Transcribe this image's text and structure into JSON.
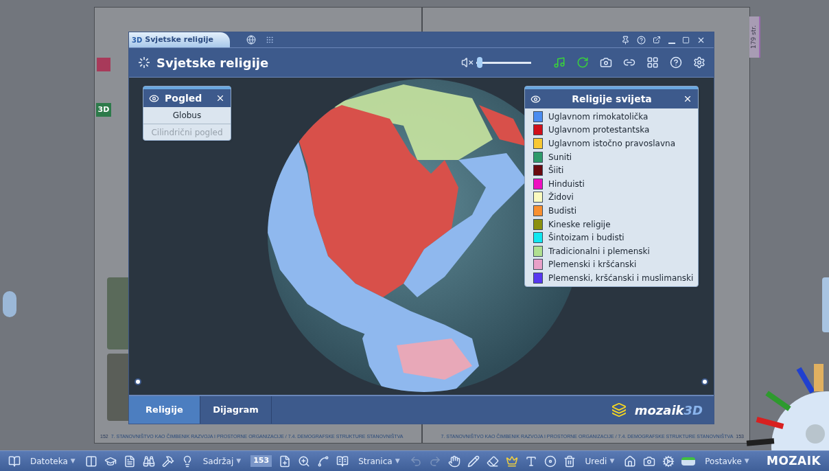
{
  "book": {
    "side_badge": "3D",
    "page_tab": "179 str.",
    "footer_left": {
      "number": "152",
      "text": "7. STANOVNIŠTVO KAO ČIMBENIK RAZVOJA I PROSTORNE ORGANIZACIJE / 7.4. DEMOGRAFSKE STRUKTURE STANOVNIŠTVA"
    },
    "footer_right": {
      "number": "153",
      "text": "7. STANOVNIŠTVO KAO ČIMBENIK RAZVOJA I PROSTORNE ORGANIZACIJE / 7.4. DEMOGRAFSKE STRUKTURE STANOVNIŠTVA"
    }
  },
  "window": {
    "tab_badge": "3D",
    "tab_title": "Svjetske religije",
    "title": "Svjetske religije",
    "volume": {
      "muted": true,
      "level": 0.04
    }
  },
  "view_panel": {
    "title": "Pogled",
    "items": [
      {
        "label": "Globus",
        "selected": true
      },
      {
        "label": "Cilindrični pogled",
        "selected": false
      }
    ]
  },
  "legend": {
    "title": "Religije svijeta",
    "items": [
      {
        "label": "Uglavnom rimokatolička",
        "color": "#4a8cf0"
      },
      {
        "label": "Uglavnom protestantska",
        "color": "#d0101a"
      },
      {
        "label": "Uglavnom istočno pravoslavna",
        "color": "#f8c832"
      },
      {
        "label": "Suniti",
        "color": "#2e9a6a"
      },
      {
        "label": "Šiiti",
        "color": "#6a0a10"
      },
      {
        "label": "Hinduisti",
        "color": "#ee10c0"
      },
      {
        "label": "Židovi",
        "color": "#fafac0"
      },
      {
        "label": "Budisti",
        "color": "#f89030"
      },
      {
        "label": "Kineske religije",
        "color": "#8a9010"
      },
      {
        "label": "Šintoizam i budisti",
        "color": "#10e8f0"
      },
      {
        "label": "Tradicionalni i plemenski",
        "color": "#b0e090"
      },
      {
        "label": "Plemenski i kršćanski",
        "color": "#e8a0c8"
      },
      {
        "label": "Plemenski, kršćanski i muslimanski",
        "color": "#5838f0"
      }
    ]
  },
  "bottom_tabs": [
    {
      "label": "Religije",
      "selected": true
    },
    {
      "label": "Dijagram",
      "selected": false
    }
  ],
  "brand": {
    "name": "mozaik",
    "suffix": "3D"
  },
  "toolbar": {
    "menus": [
      {
        "label": "Datoteka",
        "caret": "▼"
      },
      {
        "label": "Sadržaj",
        "caret": "▼"
      },
      {
        "label": "Stranica",
        "caret": "▼"
      },
      {
        "label": "Uredi",
        "caret": "▼"
      },
      {
        "label": "Postavke",
        "caret": "▼"
      }
    ],
    "page_number": "153",
    "logo": "MOZAIK"
  }
}
